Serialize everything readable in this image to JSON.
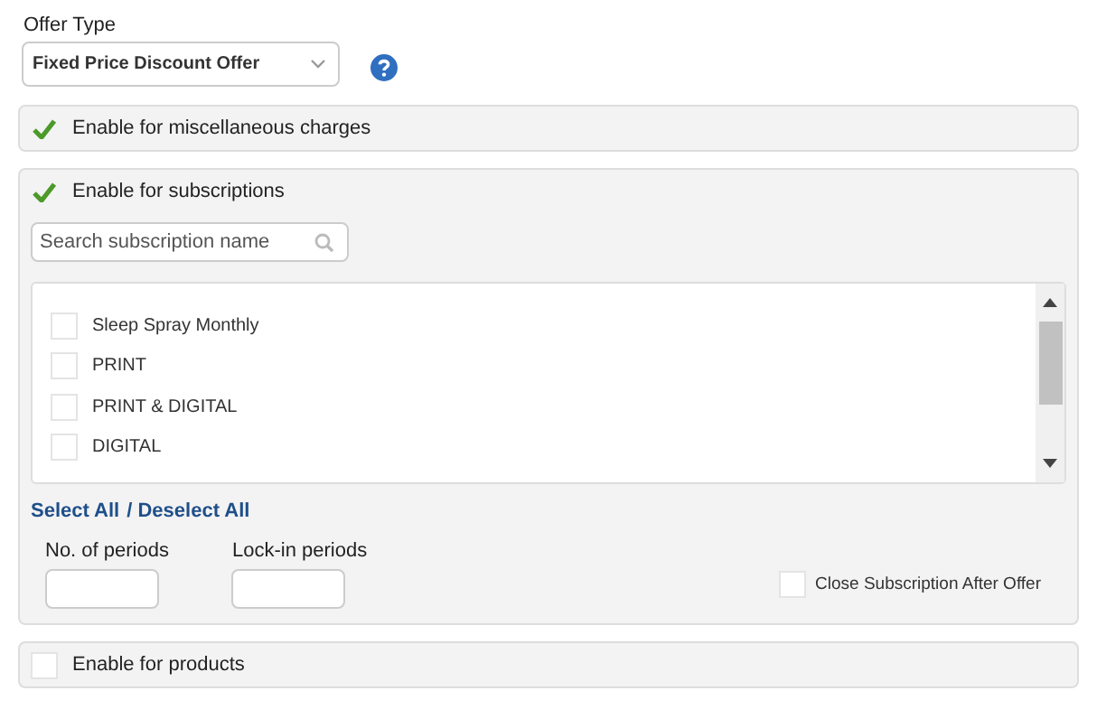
{
  "offer_type": {
    "label": "Offer Type",
    "value": "Fixed Price Discount Offer"
  },
  "misc_charges": {
    "label": "Enable for miscellaneous charges",
    "checked": true
  },
  "subscriptions": {
    "label": "Enable for subscriptions",
    "checked": true,
    "search": {
      "placeholder": "Search subscription name"
    },
    "items": [
      {
        "label": "Sleep Spray Monthly",
        "checked": false
      },
      {
        "label": "PRINT",
        "checked": false
      },
      {
        "label": "PRINT & DIGITAL",
        "checked": false
      },
      {
        "label": "DIGITAL",
        "checked": false
      }
    ],
    "select_all": "Select All",
    "deselect_all": "/ Deselect All",
    "periods_label": "No. of periods",
    "lockin_label": "Lock-in periods",
    "close_after": {
      "label": "Close Subscription After Offer",
      "checked": false
    }
  },
  "products": {
    "label": "Enable for products",
    "checked": false
  }
}
